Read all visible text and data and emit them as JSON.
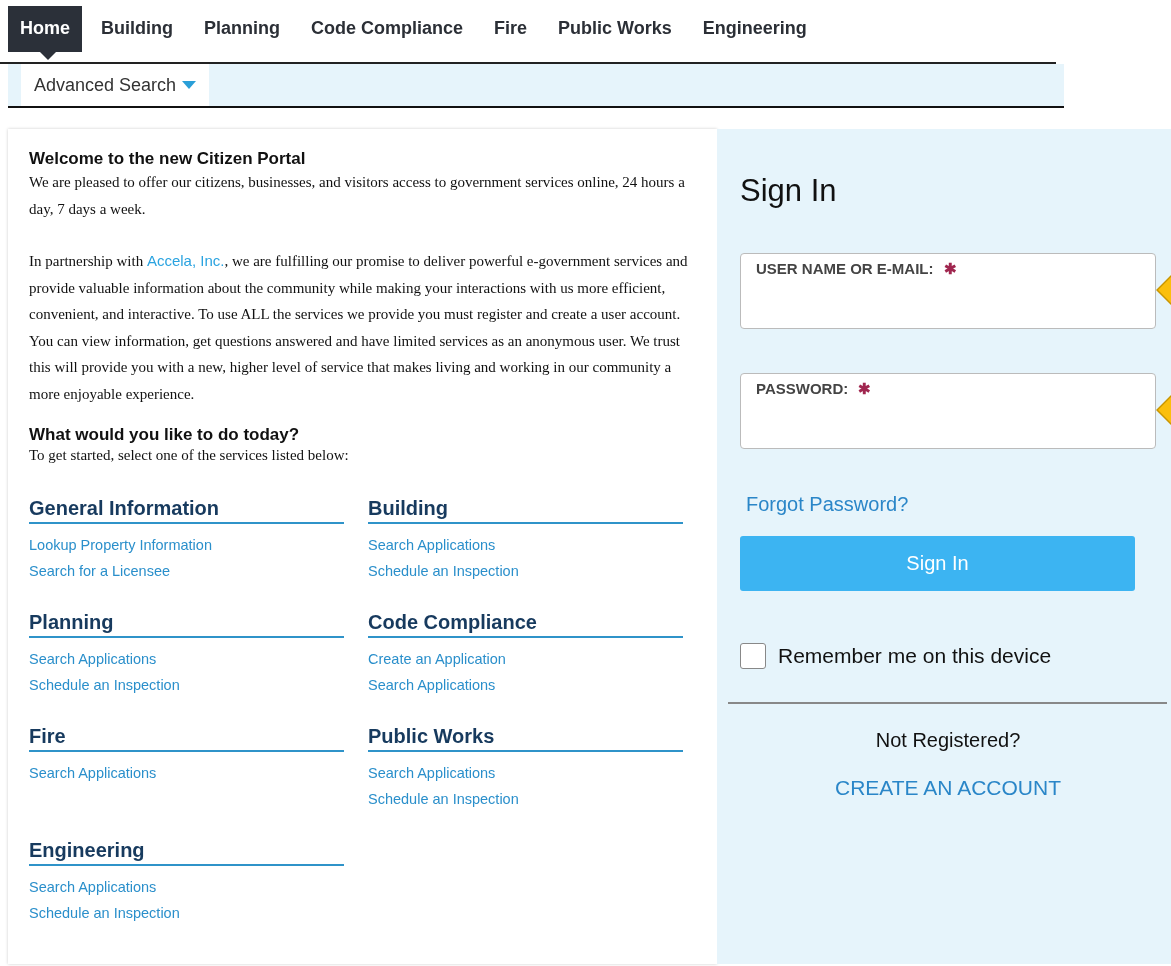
{
  "nav": {
    "tabs": [
      {
        "label": "Home",
        "selected": true
      },
      {
        "label": "Building",
        "selected": false
      },
      {
        "label": "Planning",
        "selected": false
      },
      {
        "label": "Code Compliance",
        "selected": false
      },
      {
        "label": "Fire",
        "selected": false
      },
      {
        "label": "Public Works",
        "selected": false
      },
      {
        "label": "Engineering",
        "selected": false
      }
    ]
  },
  "subnav": {
    "label": "Advanced Search"
  },
  "welcome": {
    "title": "Welcome to the new Citizen Portal",
    "paragraph": "We are pleased to offer our citizens, businesses, and visitors access to government services online, 24 hours a day, 7 days a week.",
    "partnership": {
      "before": "In partnership with ",
      "link": "Accela, Inc.",
      "after": ", we are fulfilling our promise to deliver powerful e-government services and provide valuable information about the community while making your interactions with us more efficient, convenient, and interactive. To use ALL the services we provide you must register and create a user account. You can view information, get questions answered and have limited services as an anonymous user. We trust this will provide you with a new, higher level of service that makes living and working in our community a more enjoyable experience."
    }
  },
  "prompt": {
    "title": "What would you like to do today?",
    "text": "To get started, select one of the services listed below:"
  },
  "sections": [
    {
      "title": "General Information",
      "links": [
        "Lookup Property Information",
        "Search for a Licensee"
      ]
    },
    {
      "title": "Building",
      "links": [
        "Search Applications",
        "Schedule an Inspection"
      ]
    },
    {
      "title": "Planning",
      "links": [
        "Search Applications",
        "Schedule an Inspection"
      ]
    },
    {
      "title": "Code Compliance",
      "links": [
        "Create an Application",
        "Search Applications"
      ]
    },
    {
      "title": "Fire",
      "links": [
        "Search Applications"
      ]
    },
    {
      "title": "Public Works",
      "links": [
        "Search Applications",
        "Schedule an Inspection"
      ]
    },
    {
      "title": "Engineering",
      "links": [
        "Search Applications",
        "Schedule an Inspection"
      ]
    }
  ],
  "signin": {
    "title": "Sign In",
    "required_mark": "✱",
    "fields": [
      {
        "label": "USER NAME OR E-MAIL:",
        "required": true
      },
      {
        "label": "PASSWORD:",
        "required": true
      }
    ],
    "forgot": "Forgot Password?",
    "button": "Sign In",
    "remember": {
      "label": "Remember me on this device",
      "checked": false
    },
    "not_registered": "Not Registered?",
    "create_account": "CREATE AN ACCOUNT"
  }
}
